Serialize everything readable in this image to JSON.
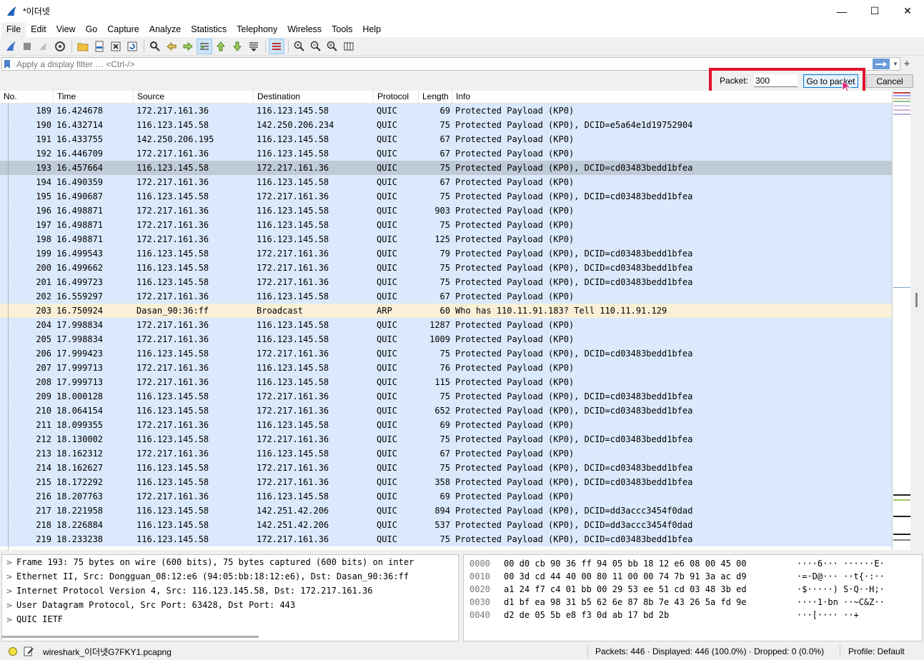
{
  "window": {
    "title": "*이더넷",
    "minimize": "—",
    "maximize": "☐",
    "close": "✕"
  },
  "menu": [
    "File",
    "Edit",
    "View",
    "Go",
    "Capture",
    "Analyze",
    "Statistics",
    "Telephony",
    "Wireless",
    "Tools",
    "Help"
  ],
  "filter": {
    "placeholder": "Apply a display filter … <Ctrl-/>",
    "plus": "+"
  },
  "goto": {
    "label": "Packet:",
    "value": "300",
    "go_label": "Go to packet",
    "cancel_label": "Cancel"
  },
  "columns": [
    "No.",
    "Time",
    "Source",
    "Destination",
    "Protocol",
    "Length",
    "Info"
  ],
  "packets": [
    {
      "no": "189",
      "time": "16.424678",
      "src": "172.217.161.36",
      "dst": "116.123.145.58",
      "proto": "QUIC",
      "len": "69",
      "info": "Protected Payload (KP0)",
      "type": "quic"
    },
    {
      "no": "190",
      "time": "16.432714",
      "src": "116.123.145.58",
      "dst": "142.250.206.234",
      "proto": "QUIC",
      "len": "75",
      "info": "Protected Payload (KP0), DCID=e5a64e1d19752904",
      "type": "quic"
    },
    {
      "no": "191",
      "time": "16.433755",
      "src": "142.250.206.195",
      "dst": "116.123.145.58",
      "proto": "QUIC",
      "len": "67",
      "info": "Protected Payload (KP0)",
      "type": "quic"
    },
    {
      "no": "192",
      "time": "16.446709",
      "src": "172.217.161.36",
      "dst": "116.123.145.58",
      "proto": "QUIC",
      "len": "67",
      "info": "Protected Payload (KP0)",
      "type": "quic"
    },
    {
      "no": "193",
      "time": "16.457664",
      "src": "116.123.145.58",
      "dst": "172.217.161.36",
      "proto": "QUIC",
      "len": "75",
      "info": "Protected Payload (KP0), DCID=cd03483bedd1bfea",
      "type": "selected"
    },
    {
      "no": "194",
      "time": "16.490359",
      "src": "172.217.161.36",
      "dst": "116.123.145.58",
      "proto": "QUIC",
      "len": "67",
      "info": "Protected Payload (KP0)",
      "type": "quic"
    },
    {
      "no": "195",
      "time": "16.490687",
      "src": "116.123.145.58",
      "dst": "172.217.161.36",
      "proto": "QUIC",
      "len": "75",
      "info": "Protected Payload (KP0), DCID=cd03483bedd1bfea",
      "type": "quic"
    },
    {
      "no": "196",
      "time": "16.498871",
      "src": "172.217.161.36",
      "dst": "116.123.145.58",
      "proto": "QUIC",
      "len": "903",
      "info": "Protected Payload (KP0)",
      "type": "quic"
    },
    {
      "no": "197",
      "time": "16.498871",
      "src": "172.217.161.36",
      "dst": "116.123.145.58",
      "proto": "QUIC",
      "len": "75",
      "info": "Protected Payload (KP0)",
      "type": "quic"
    },
    {
      "no": "198",
      "time": "16.498871",
      "src": "172.217.161.36",
      "dst": "116.123.145.58",
      "proto": "QUIC",
      "len": "125",
      "info": "Protected Payload (KP0)",
      "type": "quic"
    },
    {
      "no": "199",
      "time": "16.499543",
      "src": "116.123.145.58",
      "dst": "172.217.161.36",
      "proto": "QUIC",
      "len": "79",
      "info": "Protected Payload (KP0), DCID=cd03483bedd1bfea",
      "type": "quic"
    },
    {
      "no": "200",
      "time": "16.499662",
      "src": "116.123.145.58",
      "dst": "172.217.161.36",
      "proto": "QUIC",
      "len": "75",
      "info": "Protected Payload (KP0), DCID=cd03483bedd1bfea",
      "type": "quic"
    },
    {
      "no": "201",
      "time": "16.499723",
      "src": "116.123.145.58",
      "dst": "172.217.161.36",
      "proto": "QUIC",
      "len": "75",
      "info": "Protected Payload (KP0), DCID=cd03483bedd1bfea",
      "type": "quic"
    },
    {
      "no": "202",
      "time": "16.559297",
      "src": "172.217.161.36",
      "dst": "116.123.145.58",
      "proto": "QUIC",
      "len": "67",
      "info": "Protected Payload (KP0)",
      "type": "quic"
    },
    {
      "no": "203",
      "time": "16.750924",
      "src": "Dasan_90:36:ff",
      "dst": "Broadcast",
      "proto": "ARP",
      "len": "60",
      "info": "Who has 110.11.91.183? Tell 110.11.91.129",
      "type": "arp"
    },
    {
      "no": "204",
      "time": "17.998834",
      "src": "172.217.161.36",
      "dst": "116.123.145.58",
      "proto": "QUIC",
      "len": "1287",
      "info": "Protected Payload (KP0)",
      "type": "quic"
    },
    {
      "no": "205",
      "time": "17.998834",
      "src": "172.217.161.36",
      "dst": "116.123.145.58",
      "proto": "QUIC",
      "len": "1009",
      "info": "Protected Payload (KP0)",
      "type": "quic"
    },
    {
      "no": "206",
      "time": "17.999423",
      "src": "116.123.145.58",
      "dst": "172.217.161.36",
      "proto": "QUIC",
      "len": "75",
      "info": "Protected Payload (KP0), DCID=cd03483bedd1bfea",
      "type": "quic"
    },
    {
      "no": "207",
      "time": "17.999713",
      "src": "172.217.161.36",
      "dst": "116.123.145.58",
      "proto": "QUIC",
      "len": "76",
      "info": "Protected Payload (KP0)",
      "type": "quic"
    },
    {
      "no": "208",
      "time": "17.999713",
      "src": "172.217.161.36",
      "dst": "116.123.145.58",
      "proto": "QUIC",
      "len": "115",
      "info": "Protected Payload (KP0)",
      "type": "quic"
    },
    {
      "no": "209",
      "time": "18.000128",
      "src": "116.123.145.58",
      "dst": "172.217.161.36",
      "proto": "QUIC",
      "len": "75",
      "info": "Protected Payload (KP0), DCID=cd03483bedd1bfea",
      "type": "quic"
    },
    {
      "no": "210",
      "time": "18.064154",
      "src": "116.123.145.58",
      "dst": "172.217.161.36",
      "proto": "QUIC",
      "len": "652",
      "info": "Protected Payload (KP0), DCID=cd03483bedd1bfea",
      "type": "quic"
    },
    {
      "no": "211",
      "time": "18.099355",
      "src": "172.217.161.36",
      "dst": "116.123.145.58",
      "proto": "QUIC",
      "len": "69",
      "info": "Protected Payload (KP0)",
      "type": "quic"
    },
    {
      "no": "212",
      "time": "18.130002",
      "src": "116.123.145.58",
      "dst": "172.217.161.36",
      "proto": "QUIC",
      "len": "75",
      "info": "Protected Payload (KP0), DCID=cd03483bedd1bfea",
      "type": "quic"
    },
    {
      "no": "213",
      "time": "18.162312",
      "src": "172.217.161.36",
      "dst": "116.123.145.58",
      "proto": "QUIC",
      "len": "67",
      "info": "Protected Payload (KP0)",
      "type": "quic"
    },
    {
      "no": "214",
      "time": "18.162627",
      "src": "116.123.145.58",
      "dst": "172.217.161.36",
      "proto": "QUIC",
      "len": "75",
      "info": "Protected Payload (KP0), DCID=cd03483bedd1bfea",
      "type": "quic"
    },
    {
      "no": "215",
      "time": "18.172292",
      "src": "116.123.145.58",
      "dst": "172.217.161.36",
      "proto": "QUIC",
      "len": "358",
      "info": "Protected Payload (KP0), DCID=cd03483bedd1bfea",
      "type": "quic"
    },
    {
      "no": "216",
      "time": "18.207763",
      "src": "172.217.161.36",
      "dst": "116.123.145.58",
      "proto": "QUIC",
      "len": "69",
      "info": "Protected Payload (KP0)",
      "type": "quic"
    },
    {
      "no": "217",
      "time": "18.221958",
      "src": "116.123.145.58",
      "dst": "142.251.42.206",
      "proto": "QUIC",
      "len": "894",
      "info": "Protected Payload (KP0), DCID=dd3accc3454f0dad",
      "type": "quic"
    },
    {
      "no": "218",
      "time": "18.226884",
      "src": "116.123.145.58",
      "dst": "142.251.42.206",
      "proto": "QUIC",
      "len": "537",
      "info": "Protected Payload (KP0), DCID=dd3accc3454f0dad",
      "type": "quic"
    },
    {
      "no": "219",
      "time": "18.233238",
      "src": "116.123.145.58",
      "dst": "172.217.161.36",
      "proto": "QUIC",
      "len": "75",
      "info": "Protected Payload (KP0), DCID=cd03483bedd1bfea",
      "type": "quic"
    }
  ],
  "details": [
    "Frame 193: 75 bytes on wire (600 bits), 75 bytes captured (600 bits) on inter",
    "Ethernet II, Src: Dongguan_08:12:e6 (94:05:bb:18:12:e6), Dst: Dasan_90:36:ff",
    "Internet Protocol Version 4, Src: 116.123.145.58, Dst: 172.217.161.36",
    "User Datagram Protocol, Src Port: 63428, Dst Port: 443",
    "QUIC IETF"
  ],
  "bytes": [
    {
      "offset": "0000",
      "hex": "00 d0 cb 90 36 ff 94 05  bb 18 12 e6 08 00 45 00",
      "ascii": "····6··· ······E·"
    },
    {
      "offset": "0010",
      "hex": "00 3d cd 44 40 00 80 11  00 00 74 7b 91 3a ac d9",
      "ascii": "·=·D@··· ··t{·:··"
    },
    {
      "offset": "0020",
      "hex": "a1 24 f7 c4 01 bb 00 29  53 ee 51 cd 03 48 3b ed",
      "ascii": "·$·····) S·Q··H;·"
    },
    {
      "offset": "0030",
      "hex": "d1 bf ea 98 31 b5 62 6e  87 8b 7e 43 26 5a fd 9e",
      "ascii": "····1·bn ··~C&Z··"
    },
    {
      "offset": "0040",
      "hex": "d2 de 05 5b e8 f3 0d ab  17 bd 2b",
      "ascii": "···[···· ··+"
    }
  ],
  "status": {
    "file": "wireshark_이더넷G7FKY1.pcapng",
    "packets": "Packets: 446 · Displayed: 446 (100.0%) · Dropped: 0 (0.0%)",
    "profile": "Profile: Default"
  },
  "colors": {
    "quic_row": "#dbe9fc",
    "arp_row": "#faf0d7",
    "selected_row": "#bfcbd6",
    "highlight_box": "#e0112b"
  }
}
